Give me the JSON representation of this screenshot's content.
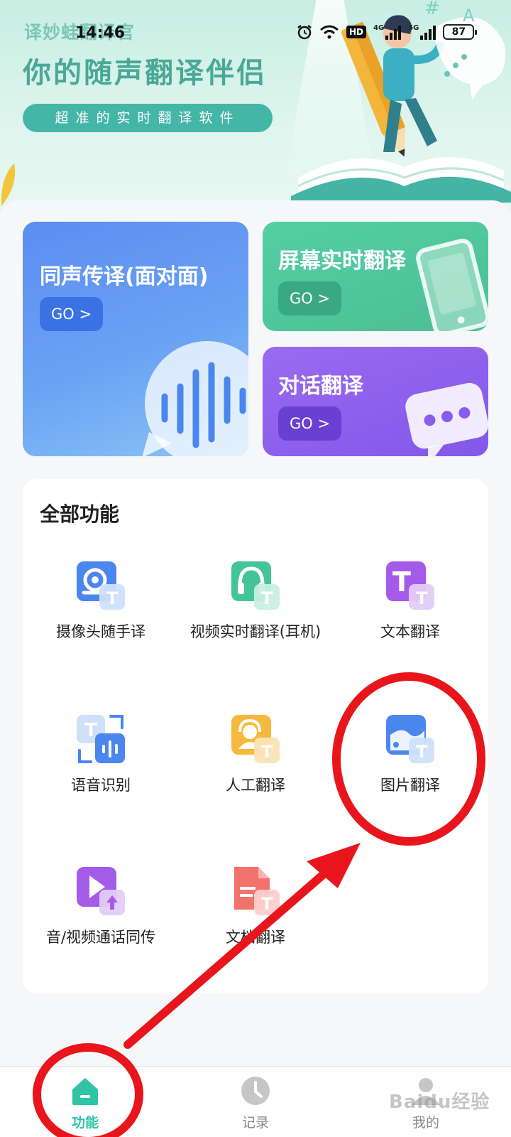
{
  "status_bar": {
    "time": "14:46",
    "battery": "87",
    "network_4g": "4G",
    "network_5g": "5G",
    "hd_label": "HD",
    "icons": [
      "alarm-icon",
      "wifi-icon",
      "hd-voice-icon",
      "signal-4g-icon",
      "signal-5g-icon",
      "battery-icon"
    ]
  },
  "hero": {
    "brand": "译妙蛙翻译官",
    "title": "你的随声翻译伴侣",
    "tagline": "超准的实时翻译软件",
    "decor": {
      "icon_a": "A",
      "icon_hash": "#"
    }
  },
  "cards": {
    "simultaneous": {
      "title": "同声传译(面对面)",
      "go": "GO >"
    },
    "screen": {
      "title": "屏幕实时翻译",
      "go": "GO >"
    },
    "dialogue": {
      "title": "对话翻译",
      "go": "GO >"
    }
  },
  "features": {
    "title": "全部功能",
    "items": [
      {
        "label": "摄像头随手译",
        "icon": "camera-translate-icon"
      },
      {
        "label": "视频实时翻译(耳机)",
        "icon": "headphone-translate-icon"
      },
      {
        "label": "文本翻译",
        "icon": "text-translate-icon"
      },
      {
        "label": "语音识别",
        "icon": "speech-recognition-icon"
      },
      {
        "label": "人工翻译",
        "icon": "human-translate-icon"
      },
      {
        "label": "图片翻译",
        "icon": "image-translate-icon"
      },
      {
        "label": "音/视频通话同传",
        "icon": "call-translate-icon"
      },
      {
        "label": "文档翻译",
        "icon": "document-translate-icon"
      }
    ]
  },
  "bottom_nav": {
    "items": [
      {
        "label": "功能",
        "icon": "home-icon",
        "active": true
      },
      {
        "label": "记录",
        "icon": "clock-icon",
        "active": false
      },
      {
        "label": "我的",
        "icon": "profile-icon",
        "active": false
      }
    ]
  },
  "colors": {
    "accent": "#2fc4a4",
    "annotation": "#e8161c",
    "card_blue": "#5c8df2",
    "card_green": "#4bbf96",
    "card_purple": "#8258ea"
  },
  "watermark": "Baidu经验"
}
